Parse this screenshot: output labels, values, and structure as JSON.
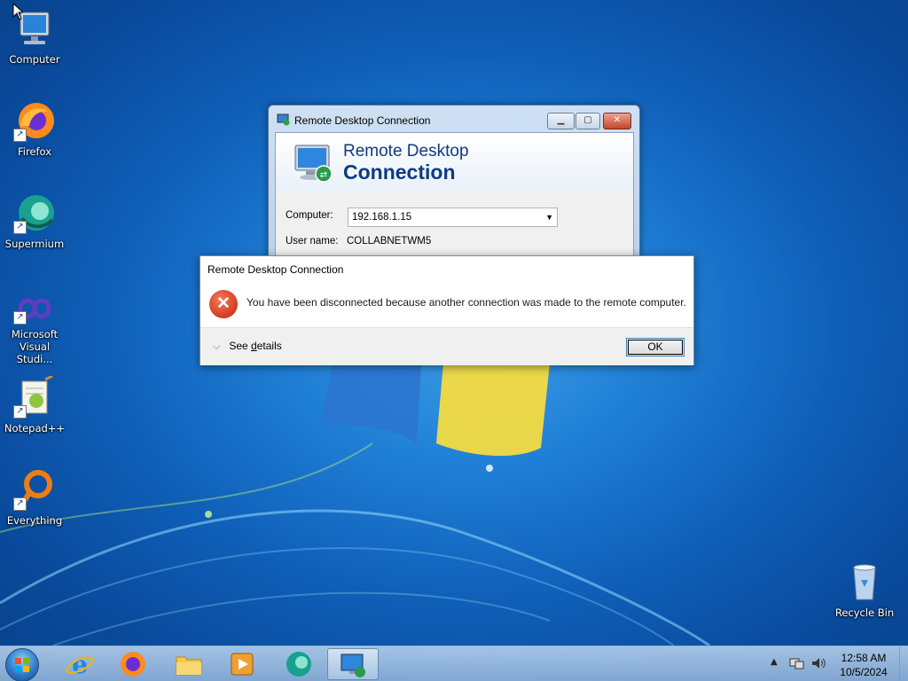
{
  "desktop": {
    "icons": [
      {
        "label": "Computer"
      },
      {
        "label": "Firefox"
      },
      {
        "label": "Supermium"
      },
      {
        "label_line1": "Microsoft",
        "label_line2": "Visual Studi..."
      },
      {
        "label": "Notepad++"
      },
      {
        "label": "Everything"
      },
      {
        "label": "Recycle Bin"
      }
    ]
  },
  "rdc_window": {
    "title": "Remote Desktop Connection",
    "banner_line1": "Remote Desktop",
    "banner_line2": "Connection",
    "computer_label": "Computer:",
    "computer_value": "192.168.1.15",
    "username_label": "User name:",
    "username_value": "COLLABNETWM5"
  },
  "message_dialog": {
    "title": "Remote Desktop Connection",
    "message": "You have been disconnected because another connection was made to the remote computer.",
    "see_details_prefix": "See ",
    "see_details_underlined": "d",
    "see_details_suffix": "etails",
    "ok_label": "OK"
  },
  "taskbar": {
    "time": "12:58 AM",
    "date": "10/5/2024"
  },
  "colors": {
    "accent": "#0d3b80",
    "error": "#d43b1f"
  }
}
